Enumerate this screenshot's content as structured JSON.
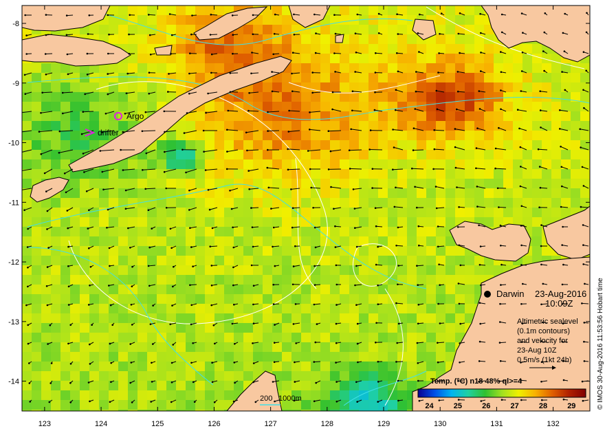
{
  "chart_data": {
    "type": "heatmap",
    "title": "Temp. (°C) n18 48% ql>=4",
    "x_ticks": [
      "123",
      "124",
      "125",
      "126",
      "127",
      "128",
      "129",
      "130",
      "131",
      "132"
    ],
    "y_ticks": [
      "-8",
      "-9",
      "-10",
      "-11",
      "-12",
      "-13",
      "-14"
    ],
    "xlim": [
      122.6,
      132.65
    ],
    "ylim": [
      -14.5,
      -7.7
    ],
    "colorbar": {
      "label": "Temp. (°C) n18 48% ql>=4",
      "ticks": [
        "24",
        "25",
        "26",
        "27",
        "28",
        "29"
      ],
      "range": [
        23.6,
        29.5
      ],
      "colors": [
        "#0a0090",
        "#0050e8",
        "#00b4f0",
        "#20d0a0",
        "#30c030",
        "#a0e020",
        "#f0f000",
        "#f8b000",
        "#e06000",
        "#b02000",
        "#800000"
      ]
    }
  },
  "place_labels": {
    "argo": "Argo",
    "drifter": "drifter",
    "darwin": "Darwin",
    "date": "23-Aug-2016",
    "time": "10:09Z"
  },
  "info_box": {
    "line1": "Altimetric sealevel",
    "line2": "(0.1m contours)",
    "line3": "and velocity for",
    "line4": "23-Aug 10Z",
    "line5": "0.5m/s (1kt 24h)"
  },
  "bathymetry_legend": {
    "label1": "200",
    "label2": "1000m"
  },
  "credit": "© IMOS 30-Aug-2016 11:53:56 Hobart time",
  "colors": {
    "land": "#f8c8a0",
    "argo_marker": "#e020e0",
    "drifter_marker": "#e020e0",
    "bathymetry": "#40e0e8",
    "contour": "#ffffff"
  }
}
